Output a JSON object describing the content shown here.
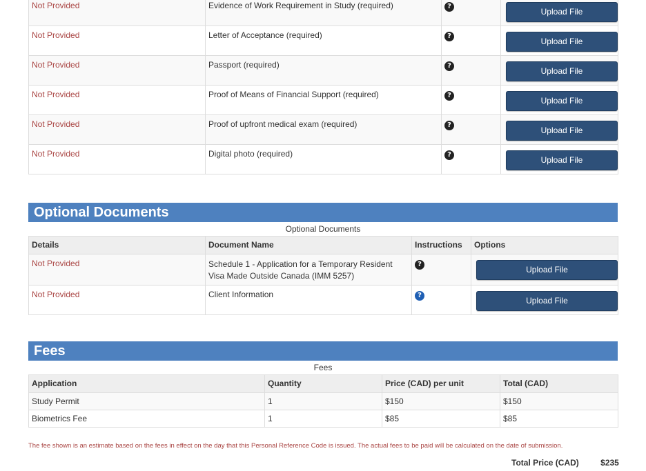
{
  "required_documents": {
    "rows": [
      {
        "status": "Not Provided",
        "name": "Evidence of Work Requirement in Study  (required)",
        "button": "Upload File"
      },
      {
        "status": "Not Provided",
        "name": "Letter of Acceptance  (required)",
        "button": "Upload File"
      },
      {
        "status": "Not Provided",
        "name": "Passport  (required)",
        "button": "Upload File"
      },
      {
        "status": "Not Provided",
        "name": "Proof of Means of Financial Support  (required)",
        "button": "Upload File"
      },
      {
        "status": "Not Provided",
        "name": "Proof of upfront medical exam  (required)",
        "button": "Upload File"
      },
      {
        "status": "Not Provided",
        "name": "Digital photo  (required)",
        "button": "Upload File"
      }
    ]
  },
  "optional_documents": {
    "title": "Optional Documents",
    "caption": "Optional Documents",
    "headers": {
      "details": "Details",
      "document_name": "Document Name",
      "instructions": "Instructions",
      "options": "Options"
    },
    "rows": [
      {
        "status": "Not Provided",
        "name": "Schedule 1 - Application for a Temporary Resident Visa Made Outside Canada (IMM 5257)",
        "button": "Upload File"
      },
      {
        "status": "Not Provided",
        "name": "Client Information",
        "button": "Upload File"
      }
    ]
  },
  "fees": {
    "title": "Fees",
    "caption": "Fees",
    "headers": {
      "application": "Application",
      "quantity": "Quantity",
      "price": "Price (CAD) per unit",
      "total": "Total (CAD)"
    },
    "rows": [
      {
        "application": "Study Permit",
        "quantity": "1",
        "price": "$150",
        "total": "$150"
      },
      {
        "application": "Biometrics Fee",
        "quantity": "1",
        "price": "$85",
        "total": "$85"
      }
    ],
    "note": "The fee shown is an estimate based on the fees in effect on the day that this Personal Reference Code is issued. The actual fees to be paid will be calculated on the date of submission.",
    "total_label": "Total Price (CAD)",
    "total_value": "$235"
  },
  "icons": {
    "help": "question-circle-icon"
  },
  "colors": {
    "header_blue": "#4e81bf",
    "button_navy": "#2e5079",
    "status_red": "#a94442"
  }
}
